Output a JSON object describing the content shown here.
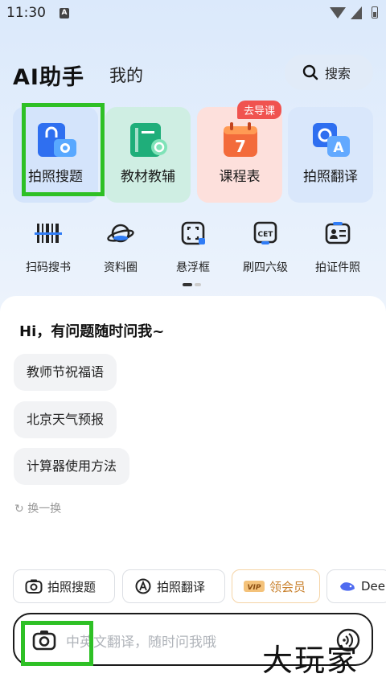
{
  "status_bar": {
    "time": "11:30",
    "sim_icon": "A"
  },
  "header": {
    "title": "AI助手",
    "tab_mine": "我的",
    "search_label": "搜索"
  },
  "feature_cards": [
    {
      "label": "拍照搜题",
      "icon": "photo-search-icon"
    },
    {
      "label": "教材教辅",
      "icon": "textbook-icon"
    },
    {
      "label": "课程表",
      "icon": "calendar-icon",
      "day": "7",
      "badge": "去导课"
    },
    {
      "label": "拍照翻译",
      "icon": "photo-translate-icon"
    }
  ],
  "tools": [
    {
      "label": "扫码搜书",
      "icon": "barcode-icon"
    },
    {
      "label": "资料圈",
      "icon": "planet-icon"
    },
    {
      "label": "悬浮框",
      "icon": "float-window-icon"
    },
    {
      "label": "刷四六级",
      "icon": "cet-icon",
      "glyph": "CET"
    },
    {
      "label": "拍证件照",
      "icon": "id-photo-icon"
    }
  ],
  "chat": {
    "greeting": "Hi，有问题随时问我~",
    "suggestions": [
      "教师节祝福语",
      "北京天气预报",
      "计算器使用方法"
    ],
    "refresh_label": "换一换"
  },
  "chips": [
    {
      "label": "拍照搜题",
      "icon": "camera-icon"
    },
    {
      "label": "拍照翻译",
      "icon": "translate-icon"
    },
    {
      "label": "领会员",
      "icon": "vip-icon",
      "tag": "VIP"
    },
    {
      "label": "Dee",
      "icon": "deepseek-icon"
    }
  ],
  "input": {
    "placeholder": "中英文翻译，随时问我哦"
  },
  "watermark": "大玩家",
  "colors": {
    "accent": "#2f7cf6",
    "highlight": "#2ec025",
    "badge": "#f0534f",
    "vip": "#c9812d"
  }
}
